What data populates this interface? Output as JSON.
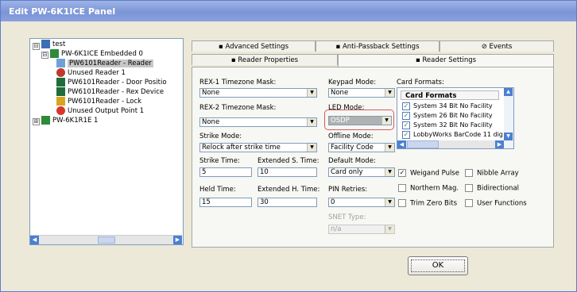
{
  "window": {
    "title": "Edit PW-6K1ICE Panel"
  },
  "tree": {
    "items": [
      {
        "label": "test",
        "icon": "folder-icon"
      },
      {
        "label": "PW-6K1ICE Embedded 0",
        "icon": "panel-icon"
      },
      {
        "label": "PW6101Reader - Reader",
        "icon": "reader-icon"
      },
      {
        "label": "Unused Reader 1",
        "icon": "unused-reader-icon"
      },
      {
        "label": "PW6101Reader - Door Positio",
        "icon": "door-icon"
      },
      {
        "label": "PW6101Reader - Rex Device",
        "icon": "rex-icon"
      },
      {
        "label": "PW6101Reader - Lock",
        "icon": "lock-icon"
      },
      {
        "label": "Unused Output Point 1",
        "icon": "output-icon"
      },
      {
        "label": "PW-6K1R1E 1",
        "icon": "panel-icon"
      }
    ],
    "expanders": [
      "⊟",
      "⊟",
      "⊞"
    ]
  },
  "tabs": {
    "row1": [
      "Advanced Settings",
      "Anti-Passback Settings",
      "Events"
    ],
    "row2": [
      "Reader Properties",
      "Reader Settings"
    ]
  },
  "form": {
    "rex1_label": "REX-1 Timezone Mask:",
    "rex1_value": "None",
    "rex2_label": "REX-2 Timezone Mask:",
    "rex2_value": "None",
    "strike_mode_label": "Strike Mode:",
    "strike_mode_value": "Relock after strike time",
    "strike_time_label": "Strike Time:",
    "strike_time_value": "5",
    "ext_strike_label": "Extended S. Time:",
    "ext_strike_value": "10",
    "held_time_label": "Held Time:",
    "held_time_value": "15",
    "ext_held_label": "Extended H. Time:",
    "ext_held_value": "30",
    "keypad_label": "Keypad Mode:",
    "keypad_value": "None",
    "led_label": "LED Mode:",
    "led_value": "OSDP",
    "offline_label": "Offline Mode:",
    "offline_value": "Facility Code",
    "default_label": "Default Mode:",
    "default_value": "Card only",
    "pin_label": "PIN Retries:",
    "pin_value": "0",
    "snet_label": "SNET Type:",
    "snet_value": "n/a"
  },
  "card_formats": {
    "label": "Card Formats:",
    "header": "Card Formats",
    "items": [
      "System 34 Bit No Facility",
      "System 26 Bit No Facility",
      "System 32 Bit No Facility",
      "LobbyWorks BarCode 11 dig"
    ]
  },
  "options": {
    "wiegand": "Weigand Pulse",
    "nibble": "Nibble Array",
    "northern": "Northern Mag.",
    "bidirectional": "Bidirectional",
    "trim": "Trim Zero Bits",
    "user_functions": "User Functions"
  },
  "buttons": {
    "ok": "OK"
  },
  "colors": {
    "title_bar": "#8aa0dc",
    "highlight": "#d45c5c",
    "osdp_bg": "#b1b1b1"
  }
}
